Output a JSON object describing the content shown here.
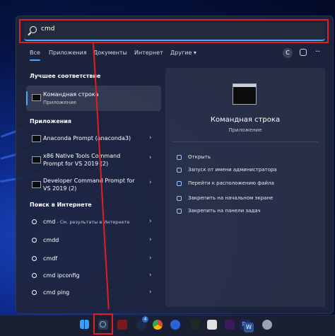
{
  "search": {
    "query": "cmd"
  },
  "tabs": [
    "Все",
    "Приложения",
    "Документы",
    "Интернет",
    "Другие ▾"
  ],
  "header": {
    "avatar_letter": "C"
  },
  "best_match": {
    "heading": "Лучшее соответствие",
    "title": "Командная строка",
    "subtitle": "Приложение"
  },
  "apps": {
    "heading": "Приложения",
    "items": [
      {
        "line1": "Anaconda Prompt (anaconda3)",
        "line2": ""
      },
      {
        "line1": "x86 Native Tools Command",
        "line2": "Prompt for VS 2019 (2)"
      },
      {
        "line1": "Developer Command Prompt for",
        "line2": "VS 2019 (2)"
      }
    ]
  },
  "web": {
    "heading": "Поиск в Интернете",
    "items": [
      {
        "term": "cmd",
        "hint": " - См. результаты в Интернете"
      },
      {
        "term": "cmdd",
        "hint": ""
      },
      {
        "term": "cmdf",
        "hint": ""
      },
      {
        "term": "cmd ipconfig",
        "hint": ""
      },
      {
        "term": "cmd ping",
        "hint": ""
      }
    ]
  },
  "preview": {
    "title": "Командная строка",
    "subtitle": "Приложение",
    "actions": [
      "Открыть",
      "Запуск от имени администратора",
      "Перейти к расположению файла",
      "Закрепить на начальном экране",
      "Закрепить на панели задач"
    ]
  },
  "taskbar": {
    "badge": "4",
    "ps_label": "Ps",
    "w_label": "W"
  },
  "colors": {
    "accent": "#4aa8ff",
    "annotation": "#e02020"
  }
}
